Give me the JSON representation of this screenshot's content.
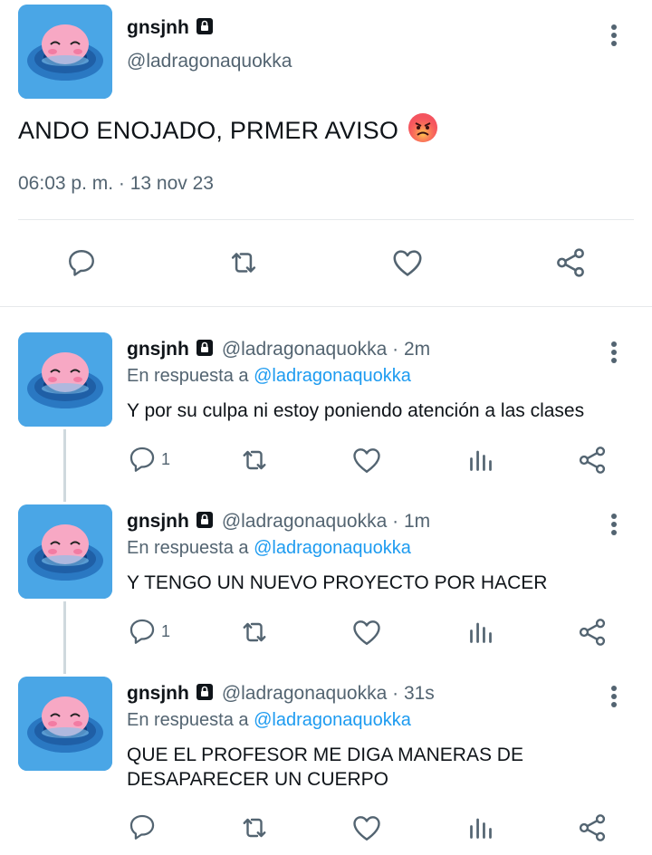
{
  "main_tweet": {
    "display_name": "gnsjnh",
    "handle": "@ladragonaquokka",
    "text": "ANDO ENOJADO, PRMER AVISO",
    "emoji": "😡",
    "timestamp": "06:03 p. m. · 13 nov 23"
  },
  "replies": [
    {
      "display_name": "gnsjnh",
      "meta": "@ladragonaquokka · 2m",
      "reply_prefix": "En respuesta a",
      "reply_mention": "@ladragonaquokka",
      "text": "Y por su culpa ni estoy poniendo atención a las clases",
      "reply_count": "1"
    },
    {
      "display_name": "gnsjnh",
      "meta": "@ladragonaquokka · 1m",
      "reply_prefix": "En respuesta a",
      "reply_mention": "@ladragonaquokka",
      "text": "Y TENGO UN NUEVO PROYECTO POR HACER",
      "reply_count": "1"
    },
    {
      "display_name": "gnsjnh",
      "meta": "@ladragonaquokka · 31s",
      "reply_prefix": "En respuesta a",
      "reply_mention": "@ladragonaquokka",
      "text_line1": "QUE EL PROFESOR ME DIGA MANERAS DE",
      "text_line2": "DESAPARECER UN CUERPO",
      "reply_count": ""
    }
  ],
  "colors": {
    "accent": "#1d9bf0",
    "secondary_text": "#536471",
    "divider": "#e6e9eb"
  }
}
